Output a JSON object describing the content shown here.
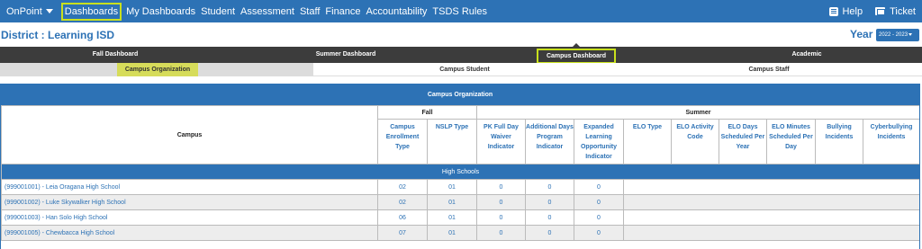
{
  "topnav": {
    "brand": "OnPoint",
    "items": [
      "Dashboards",
      "My Dashboards",
      "Student",
      "Assessment",
      "Staff",
      "Finance",
      "Accountability",
      "TSDS Rules"
    ],
    "help": "Help",
    "ticket": "Ticket"
  },
  "district": {
    "title": "District : Learning ISD"
  },
  "year": {
    "label": "Year",
    "selected": "2022 - 2023"
  },
  "tabs": [
    "Fall Dashboard",
    "Summer Dashboard",
    "Campus Dashboard",
    "Academic"
  ],
  "subtabs": [
    "Campus Organization",
    "Campus Student",
    "Campus Staff"
  ],
  "table": {
    "title": "Campus Organization",
    "groups": {
      "campus": "Campus",
      "fall": "Fall",
      "summer": "Summer"
    },
    "columns": [
      "Campus Enrollment Type",
      "NSLP Type",
      "PK Full Day Waiver Indicator",
      "Additional Days Program Indicator",
      "Expanded Learning Opportunity Indicator",
      "ELO Type",
      "ELO Activity Code",
      "ELO Days Scheduled Per Year",
      "ELO Minutes Scheduled Per Day",
      "Bullying Incidents",
      "Cyberbullying Incidents"
    ],
    "section": "High Schools",
    "rows": [
      {
        "campus": "(999001001) - Leia Oragana High School",
        "enroll": "02",
        "nslp": "01",
        "pk": "0",
        "add": "0",
        "elo": "0"
      },
      {
        "campus": "(999001002) - Luke Skywalker High School",
        "enroll": "02",
        "nslp": "01",
        "pk": "0",
        "add": "0",
        "elo": "0"
      },
      {
        "campus": "(999001003) - Han Solo High School",
        "enroll": "06",
        "nslp": "01",
        "pk": "0",
        "add": "0",
        "elo": "0"
      },
      {
        "campus": "(999001005) - Chewbacca High School",
        "enroll": "07",
        "nslp": "01",
        "pk": "0",
        "add": "0",
        "elo": "0"
      }
    ]
  },
  "colors": {
    "primary": "#2d72b5",
    "highlight": "#c8e01d",
    "tabbar": "#3c3c3c"
  },
  "icons": {
    "brand_caret": "caret-down-icon",
    "help": "help-book-icon",
    "ticket": "ticket-icon"
  }
}
